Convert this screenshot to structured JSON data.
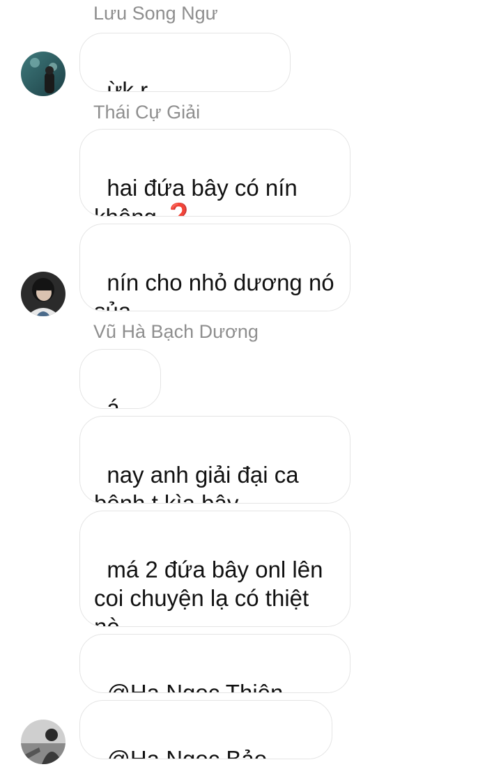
{
  "thread": [
    {
      "sender": "Lưu Song Ngư",
      "avatar_icon": "user-avatar-icon",
      "messages": [
        {
          "text": "ừk r s",
          "suffix": "❓❓❓❓"
        }
      ]
    },
    {
      "sender": "Thái Cự Giải",
      "avatar_icon": "user-avatar-icon",
      "messages": [
        {
          "text": "hai đứa bây có nín\nkhông ",
          "suffix": "❓"
        },
        {
          "text": "nín cho nhỏ dương nó\nsủa",
          "suffix": ""
        }
      ]
    },
    {
      "sender": "Vũ Hà Bạch Dương",
      "avatar_icon": "user-avatar-icon",
      "messages": [
        {
          "text": "á đù",
          "suffix": ""
        },
        {
          "text": "nay anh giải đại ca\nbênh t kìa bây",
          "suffix": ""
        },
        {
          "text": "má 2 đứa bây onl lên\ncoi chuyện lạ có thiệt\nnè",
          "suffix": ""
        },
        {
          "text": "@Hạ Ngọc Thiên Bình",
          "suffix": ""
        },
        {
          "text": "@Hạ Ngọc Bảo Bình",
          "suffix": ""
        }
      ]
    }
  ],
  "colors": {
    "sender_name": "#8e8e8e",
    "bubble_border": "#e4e4e4",
    "question_mark": "#d9221f"
  }
}
